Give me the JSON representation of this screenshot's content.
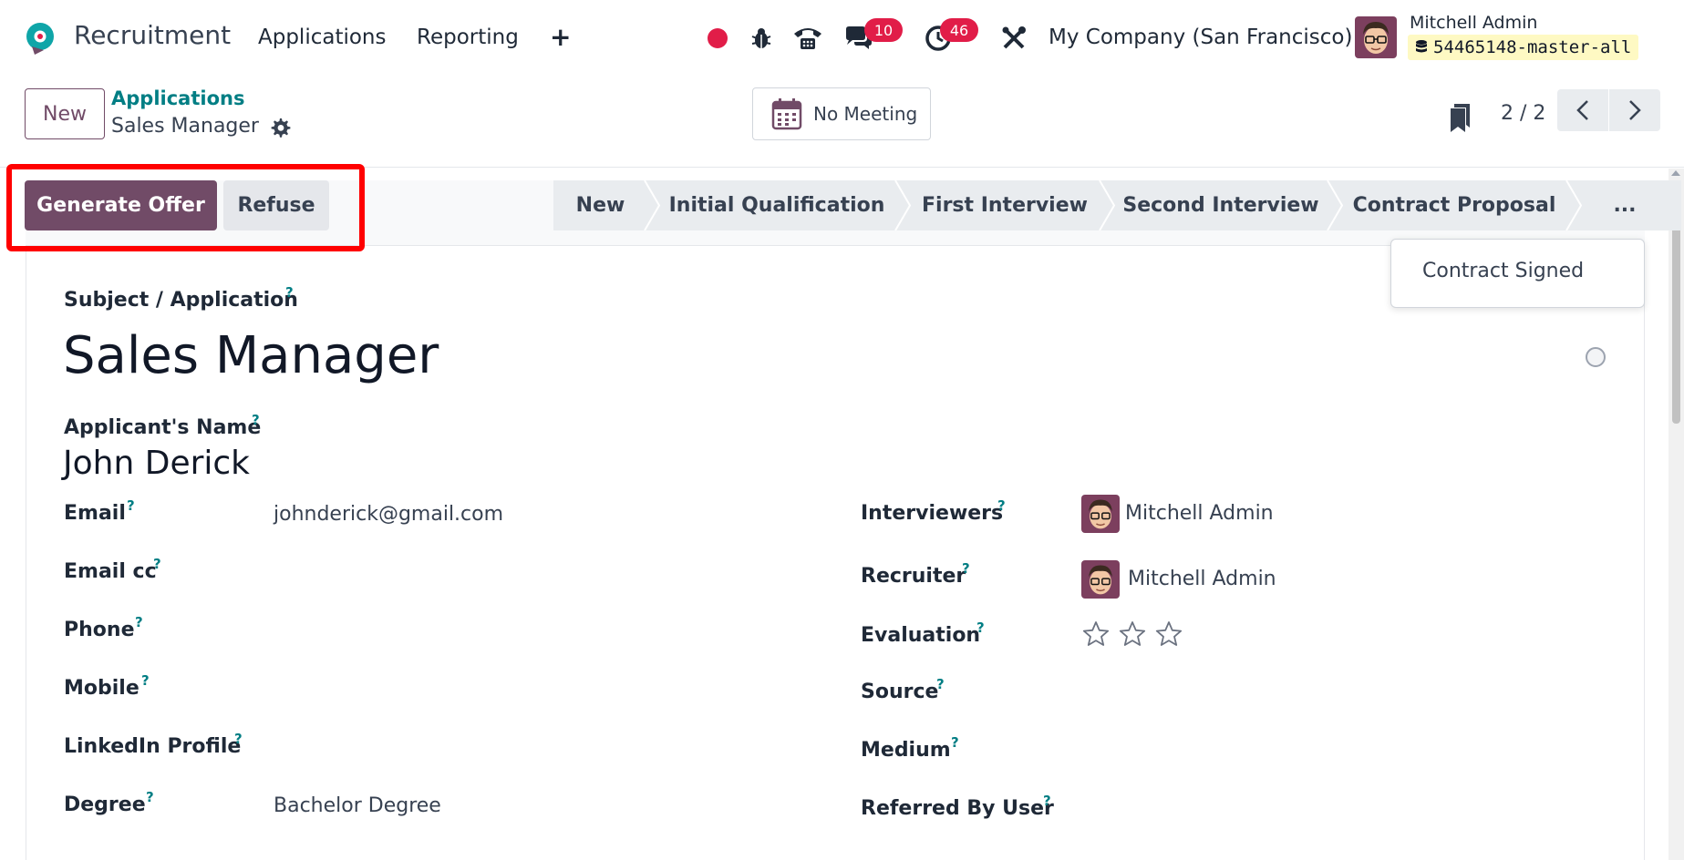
{
  "navbar": {
    "app_name": "Recruitment",
    "menu": [
      "Applications",
      "Reporting"
    ],
    "plus": "+",
    "messages_count": "10",
    "activities_count": "46",
    "company": "My Company (San Francisco)",
    "user_name": "Mitchell Admin",
    "database": "54465148-master-all"
  },
  "control_panel": {
    "new_label": "New",
    "breadcrumb_parent": "Applications",
    "breadcrumb_current": "Sales Manager",
    "meeting_label": "No Meeting",
    "pager": "2 / 2"
  },
  "statusbar": {
    "generate_offer": "Generate Offer",
    "refuse": "Refuse",
    "stages": [
      "New",
      "Initial Qualification",
      "First Interview",
      "Second Interview",
      "Contract Proposal"
    ],
    "more": "...",
    "dropdown_item": "Contract Signed"
  },
  "form": {
    "subject_label": "Subject / Application",
    "title": "Sales Manager",
    "applicant_label": "Applicant's Name",
    "applicant_name": "John Derick",
    "help_mark": "?",
    "left_fields": [
      {
        "label": "Email",
        "value": "johnderick@gmail.com"
      },
      {
        "label": "Email cc",
        "value": ""
      },
      {
        "label": "Phone",
        "value": ""
      },
      {
        "label": "Mobile",
        "value": ""
      },
      {
        "label": "LinkedIn Profile",
        "value": ""
      },
      {
        "label": "Degree",
        "value": "Bachelor Degree"
      }
    ],
    "right_fields": [
      {
        "label": "Interviewers",
        "value": "Mitchell Admin"
      },
      {
        "label": "Recruiter",
        "value": "Mitchell Admin"
      },
      {
        "label": "Evaluation",
        "value": ""
      },
      {
        "label": "Source",
        "value": ""
      },
      {
        "label": "Medium",
        "value": ""
      },
      {
        "label": "Referred By User",
        "value": ""
      }
    ],
    "evaluation_stars": 0
  },
  "colors": {
    "brand": "#714b67",
    "link": "#017e84",
    "badge": "#e11d48",
    "highlight": "#ff0000"
  }
}
